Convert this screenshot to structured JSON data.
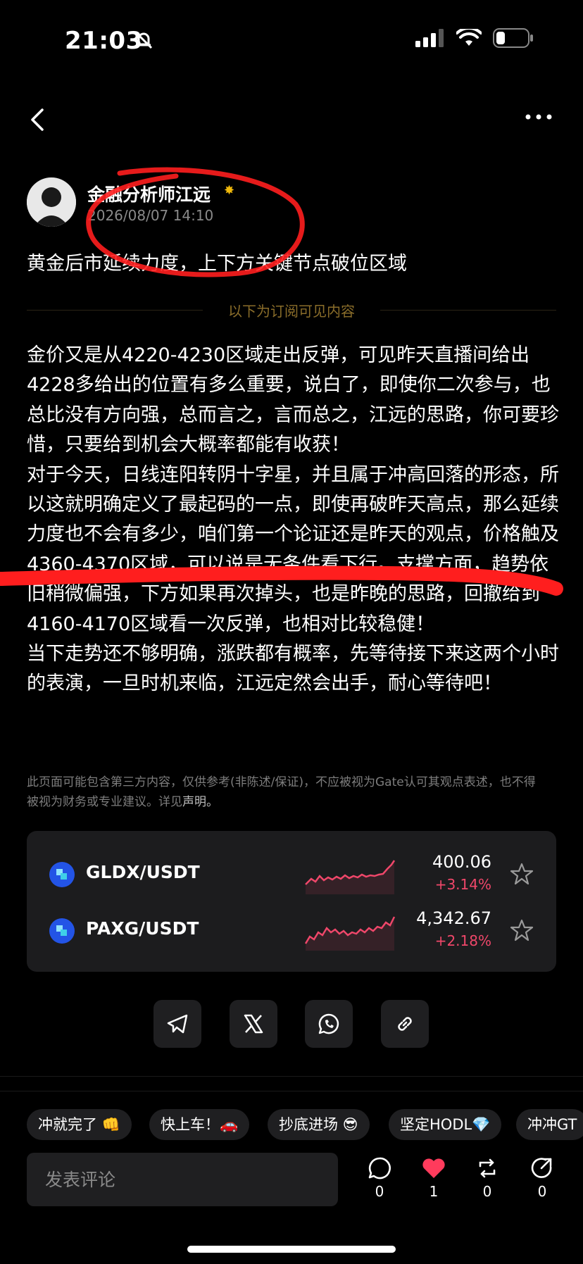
{
  "status_bar": {
    "time": "21:03"
  },
  "author": {
    "name": "金融分析师江远",
    "date": "2026/08/07 14:10"
  },
  "post": {
    "title": "黄金后市延续力度，上下方关键节点破位区域",
    "divider_label": "以下为订阅可见内容",
    "paragraphs": [
      "金价又是从4220-4230区域走出反弹，可见昨天直播间给出4228多给出的位置有多么重要，说白了，即使你二次参与，也总比没有方向强，总而言之，言而总之，江远的思路，你可要珍惜，只要给到机会大概率都能有收获！",
      "对于今天，日线连阳转阴十字星，并且属于冲高回落的形态，所以这就明确定义了最起码的一点，即使再破昨天高点，那么延续力度也不会有多少，咱们第一个论证还是昨天的观点，价格触及4360-4370区域，可以说是无条件看下行。支撑方面，趋势依旧稍微偏强，下方如果再次掉头，也是昨晚的思路，回撤给到4160-4170区域看一次反弹，也相对比较稳健！",
      "当下走势还不够明确，涨跌都有概率，先等待接下来这两个小时的表演，一旦时机来临，江远定然会出手，耐心等待吧！"
    ],
    "disclaimer": "此页面可能包含第三方内容，仅供参考(非陈述/保证)，不应被视为Gate认可其观点表述，也不得被视为财务或专业建议。详见",
    "disclaimer_link": "声明。"
  },
  "market": [
    {
      "pair": "GLDX/USDT",
      "price": "400.06",
      "change": "+3.14%",
      "icon": "token-icon"
    },
    {
      "pair": "PAXG/USDT",
      "price": "4,342.67",
      "change": "+2.18%",
      "icon": "token-icon"
    }
  ],
  "share": [
    "telegram-icon",
    "x-icon",
    "whatsapp-icon",
    "link-icon"
  ],
  "chips": [
    "冲就完了 👊",
    "快上车！🚗",
    "抄底进场 😎",
    "坚定HODL💎",
    "冲冲GT"
  ],
  "comment": {
    "placeholder": "发表评论"
  },
  "actions": [
    {
      "name": "comment",
      "count": "0"
    },
    {
      "name": "like",
      "count": "1"
    },
    {
      "name": "repost",
      "count": "0"
    },
    {
      "name": "share",
      "count": "0"
    }
  ],
  "colors": {
    "accent_red": "#f0476a",
    "like_red": "#ff3b5c",
    "annotation_red": "#ff1e1e",
    "divider_gold": "#8a6d2a"
  }
}
